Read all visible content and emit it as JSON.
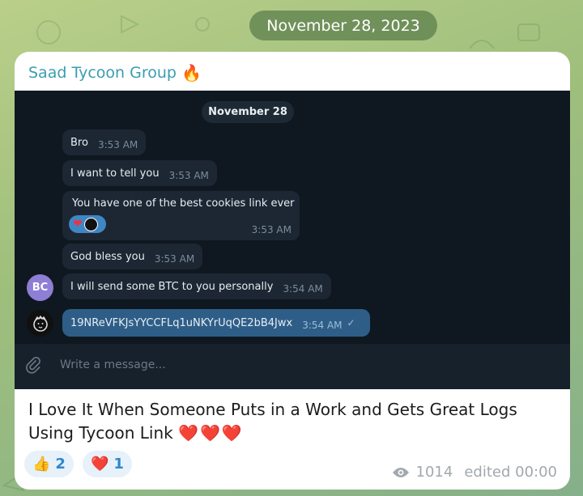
{
  "date_pill": "November 28, 2023",
  "post": {
    "channel_name": "Saad Tycoon Group",
    "channel_emoji": "🔥",
    "caption": "I Love It When Someone Puts in a Work and Gets Great Logs Using Tycoon Link",
    "caption_emojis": "❤️❤️❤️",
    "reactions": [
      {
        "emoji": "👍",
        "count": "2"
      },
      {
        "emoji": "❤️",
        "count": "1"
      }
    ],
    "views": "1014",
    "edited": "edited 00:00"
  },
  "screenshot": {
    "date": "November 28",
    "messages": [
      {
        "text": "Bro",
        "time": "3:53 AM"
      },
      {
        "text": "I want to tell you",
        "time": "3:53 AM"
      },
      {
        "text": "You have one of the best cookies link ever",
        "time": "3:53 AM"
      },
      {
        "text": "God bless you",
        "time": "3:53 AM"
      },
      {
        "text": "I will send some BTC to you personally",
        "time": "3:54 AM"
      },
      {
        "text": "19NReVFKJsYYCCFLq1uNKYrUqQE2bB4Jwx",
        "time": "3:54 AM"
      }
    ],
    "sender_initials": "BC",
    "composer_placeholder": "Write a message..."
  },
  "colors": {
    "accent": "#3a9db0",
    "dark_bg": "#0f1820",
    "bubble_in": "#1c2733",
    "bubble_out": "#2e5e88",
    "reaction_bg": "#e6f1fa"
  }
}
